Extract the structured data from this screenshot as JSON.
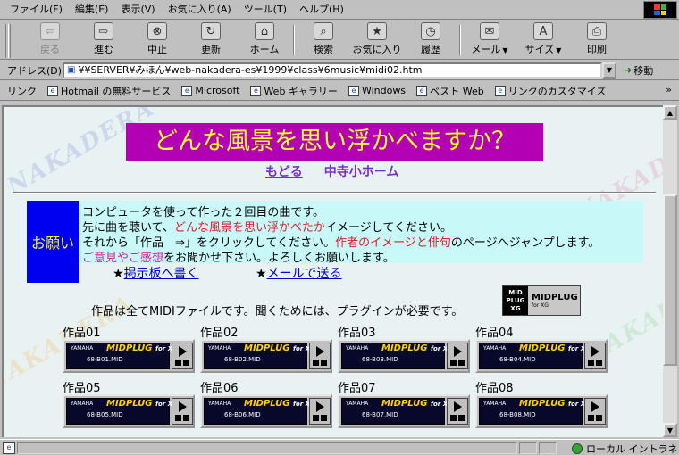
{
  "menu": [
    "ファイル(F)",
    "編集(E)",
    "表示(V)",
    "お気に入り(A)",
    "ツール(T)",
    "ヘルプ(H)"
  ],
  "toolbar": {
    "back": "戻る",
    "forward": "進む",
    "stop": "中止",
    "refresh": "更新",
    "home": "ホーム",
    "search": "検索",
    "favorites": "お気に入り",
    "history": "履歴",
    "mail": "メール",
    "size": "サイズ",
    "print": "印刷"
  },
  "address": {
    "label": "アドレス(D)",
    "url": "¥¥SERVER¥みほん¥web-nakadera-es¥1999¥class¥6music¥midi02.htm",
    "go": "移動"
  },
  "links": {
    "label": "リンク",
    "items": [
      "Hotmail の無料サービス",
      "Microsoft",
      "Web ギャラリー",
      "Windows",
      "ベスト Web",
      "リンクのカスタマイズ"
    ]
  },
  "page": {
    "watermark": "NAKADERA",
    "title": "どんな風景を思い浮かべますか？",
    "nav_back": "もどる",
    "nav_home": "中寺小ホーム",
    "request_label": "お願い",
    "line1": "コンピュータを使って作った２回目の曲です。",
    "line2a": "先に曲を聴いて、",
    "line2b": "どんな風景を思い浮かべたか",
    "line2c": "イメージしてください。",
    "line3a": "それから「作品　⇒」をクリックしてください。",
    "line3b": "作者のイメージと俳句",
    "line3c": "のページへジャンプします。",
    "line4a": "ご意見やご感想",
    "line4b": "をお聞かせ下さい。よろしくお願いします。",
    "bbs": "掲示板へ書く",
    "mail": "メールで送る",
    "star": "★",
    "midi_note": "作品は全てMIDIファイルです。聞くためには、プラグインが必要です。",
    "logo_mid": "MID",
    "logo_plug": "PLUG",
    "logo_xg": "XG",
    "logo_name": "MIDPLUG",
    "logo_for": "for XG"
  },
  "player": {
    "brand": "YAMAHA",
    "name": "MIDPLUG",
    "for": "for XG"
  },
  "songs": [
    {
      "label": "作品01",
      "file": "68-B01.MID"
    },
    {
      "label": "作品02",
      "file": "68-B02.MID"
    },
    {
      "label": "作品03",
      "file": "68-B03.MID"
    },
    {
      "label": "作品04",
      "file": "68-B04.MID"
    },
    {
      "label": "作品05",
      "file": "68-B05.MID"
    },
    {
      "label": "作品06",
      "file": "68-B06.MID"
    },
    {
      "label": "作品07",
      "file": "68-B07.MID"
    },
    {
      "label": "作品08",
      "file": "68-B08.MID"
    }
  ],
  "status": {
    "zone": "ローカル イントラネット"
  },
  "colors": {
    "title_bg": "#b400b4",
    "title_fg": "#ffff32",
    "request_bg": "#0000f0",
    "message_bg": "#c8f8f8",
    "emphasis_red": "#dc1e28",
    "link_blue": "#0000c8"
  }
}
